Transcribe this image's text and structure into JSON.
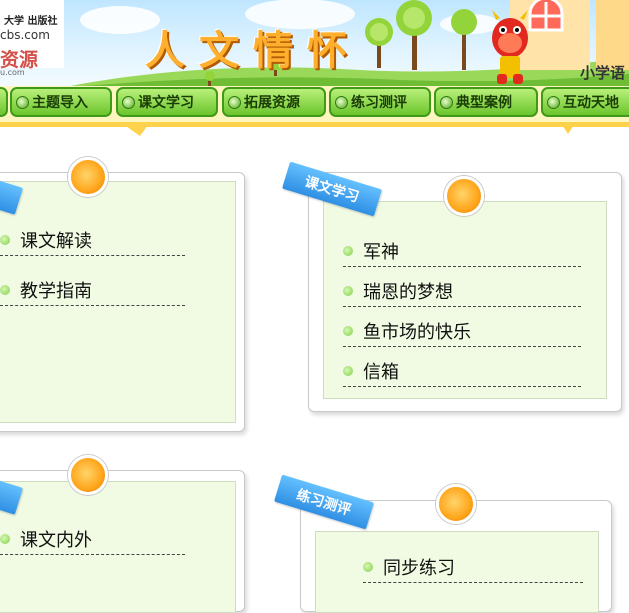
{
  "header": {
    "logo_line1": "大学 出版社",
    "logo_line2": "cbs.com",
    "logo_line3": "资源",
    "logo_line4": "u.com",
    "title": "人文情怀",
    "school_label": "小学语"
  },
  "nav": {
    "tabs": [
      "主题导入",
      "课文学习",
      "拓展资源",
      "练习测评",
      "典型案例",
      "互动天地"
    ]
  },
  "panels": {
    "theme": {
      "items": [
        "课文解读",
        "教学指南"
      ]
    },
    "lessons": {
      "ribbon": "课文学习",
      "items": [
        "军神",
        "瑞恩的梦想",
        "鱼市场的快乐",
        "信箱"
      ]
    },
    "extend": {
      "items": [
        "课文内外"
      ]
    },
    "practice": {
      "ribbon": "练习测评",
      "items": [
        "同步练习"
      ]
    }
  },
  "colors": {
    "title_orange": "#ffaf2e",
    "tab_green": "#6cc52d",
    "panel_bg": "#f1fbe3",
    "ribbon_blue": "#2f8fe3"
  }
}
